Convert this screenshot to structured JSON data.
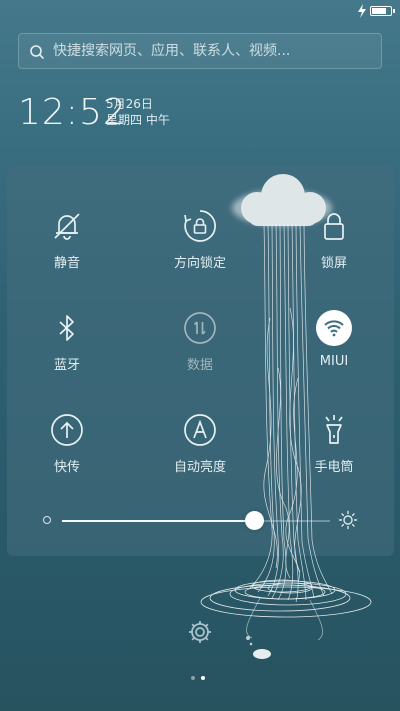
{
  "search": {
    "placeholder": "快捷搜索网页、应用、联系人、视频..."
  },
  "clock": {
    "time": "12:52",
    "date": "5月26日",
    "weekday": "星期四 中午"
  },
  "toggles": [
    {
      "label": "静音",
      "icon": "bell-off-icon",
      "state": "off"
    },
    {
      "label": "方向锁定",
      "icon": "rotation-lock-icon",
      "state": "off"
    },
    {
      "label": "锁屏",
      "icon": "lock-icon",
      "state": "off"
    },
    {
      "label": "蓝牙",
      "icon": "bluetooth-icon",
      "state": "off"
    },
    {
      "label": "数据",
      "icon": "mobile-data-icon",
      "state": "disabled"
    },
    {
      "label": "MIUI",
      "icon": "wifi-icon",
      "state": "on"
    },
    {
      "label": "快传",
      "icon": "upload-icon",
      "state": "off"
    },
    {
      "label": "自动亮度",
      "icon": "auto-brightness-icon",
      "state": "off"
    },
    {
      "label": "手电筒",
      "icon": "flashlight-icon",
      "state": "off"
    }
  ],
  "brightness": {
    "level_fraction": 0.72
  },
  "pager": {
    "pages": 2,
    "current": 2
  },
  "colors": {
    "active_toggle": "#ffffff",
    "icon_stroke": "#e7f1f4",
    "disabled": "#9fb6bd"
  }
}
